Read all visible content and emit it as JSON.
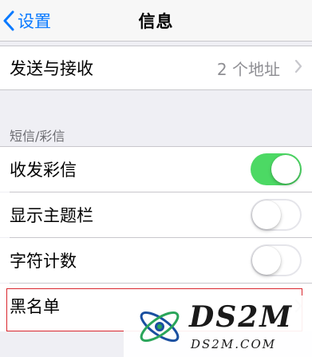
{
  "nav": {
    "back_label": "设置",
    "title": "信息",
    "back_icon": "chevron-left-icon"
  },
  "send_receive": {
    "label": "发送与接收",
    "value": "2 个地址",
    "icon": "chevron-right-icon"
  },
  "mms_section": {
    "header": "短信/彩信",
    "rows": [
      {
        "label": "收发彩信",
        "toggle_on": true
      },
      {
        "label": "显示主题栏",
        "toggle_on": false
      },
      {
        "label": "字符计数",
        "toggle_on": false
      }
    ],
    "blacklist_label": "黑名单"
  },
  "colors": {
    "accent": "#0a7aff",
    "toggle_on": "#4cd964",
    "highlight": "#d9262d"
  },
  "watermark": {
    "brand": "DS2M",
    "domain": "DS2M.COM",
    "logo_icon": "atom-logo-icon"
  }
}
